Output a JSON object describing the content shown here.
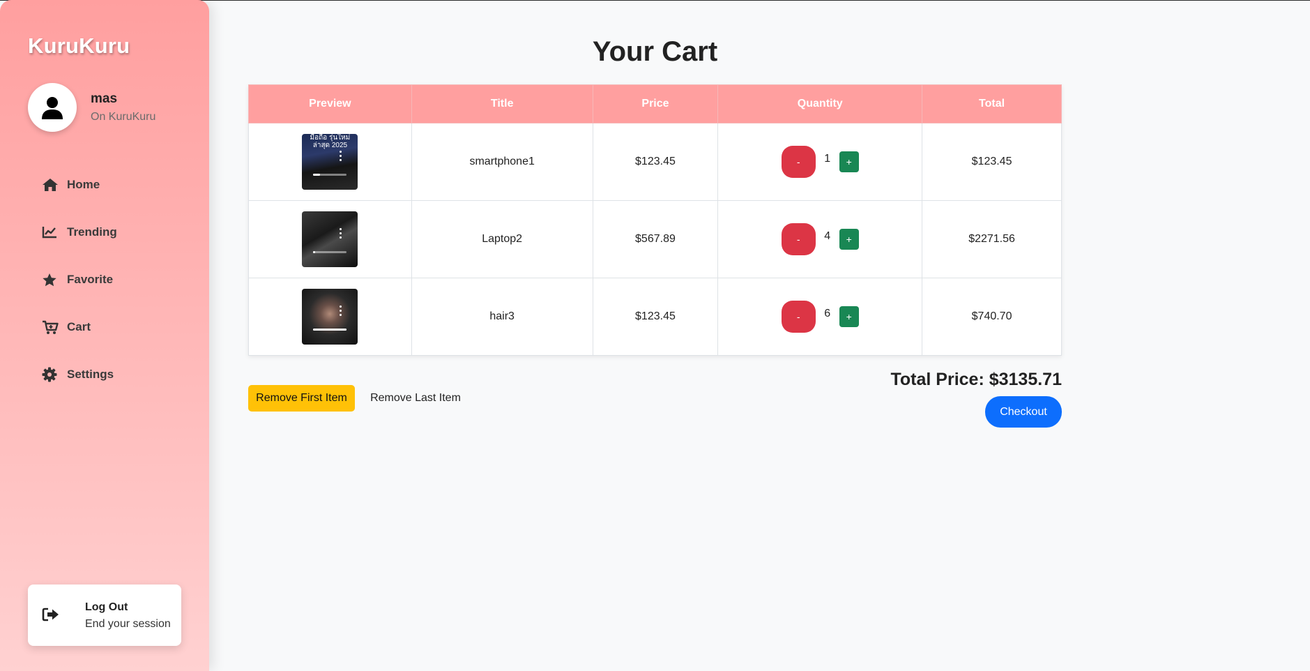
{
  "app": {
    "brand": "KuruKuru"
  },
  "profile": {
    "name": "mas",
    "subtitle": "On KuruKuru"
  },
  "sidebar": {
    "items": [
      {
        "label": "Home",
        "icon": "home-icon"
      },
      {
        "label": "Trending",
        "icon": "chart-line-icon"
      },
      {
        "label": "Favorite",
        "icon": "star-icon"
      },
      {
        "label": "Cart",
        "icon": "cart-icon"
      },
      {
        "label": "Settings",
        "icon": "gear-icon"
      }
    ],
    "logout": {
      "title": "Log Out",
      "subtitle": "End your session",
      "icon": "sign-out-icon"
    }
  },
  "cart": {
    "title": "Your Cart",
    "columns": [
      "Preview",
      "Title",
      "Price",
      "Quantity",
      "Total"
    ],
    "rows": [
      {
        "title": "smartphone1",
        "price": "$123.45",
        "quantity": "1",
        "total": "$123.45",
        "thumb_caption": "มือถือ รุ่นใหม่ ล่าสุด 2025",
        "progress": 0.2
      },
      {
        "title": "Laptop2",
        "price": "$567.89",
        "quantity": "4",
        "total": "$2271.56",
        "thumb_caption": "",
        "progress": 0.05
      },
      {
        "title": "hair3",
        "price": "$123.45",
        "quantity": "6",
        "total": "$740.70",
        "thumb_caption": "",
        "progress": 1.0
      }
    ],
    "minus_label": "-",
    "plus_label": "+",
    "remove_first_label": "Remove First Item",
    "remove_last_label": "Remove Last Item",
    "total_label": "Total Price: $3135.71",
    "checkout_label": "Checkout"
  },
  "colors": {
    "accent": "#ff9f9f",
    "minus": "#dc3545",
    "plus": "#198754",
    "checkout": "#0d6efd",
    "remove_first": "#ffc107"
  }
}
